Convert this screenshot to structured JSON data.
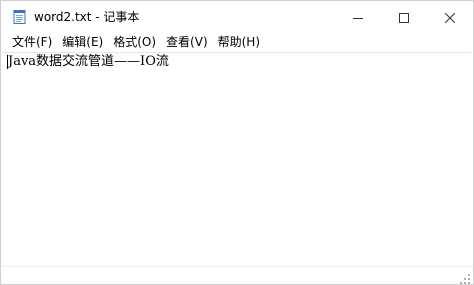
{
  "window": {
    "title": "word2.txt - 记事本"
  },
  "menubar": {
    "items": [
      {
        "label": "文件(F)"
      },
      {
        "label": "编辑(E)"
      },
      {
        "label": "格式(O)"
      },
      {
        "label": "查看(V)"
      },
      {
        "label": "帮助(H)"
      }
    ]
  },
  "editor": {
    "content": "Java数据交流管道——IO流"
  },
  "icons": {
    "app": "notepad-icon",
    "minimize": "minimize-icon",
    "maximize": "maximize-icon",
    "close": "close-icon"
  },
  "colors": {
    "background": "#ffffff",
    "text": "#000000",
    "chrome_icon": "#333333"
  }
}
